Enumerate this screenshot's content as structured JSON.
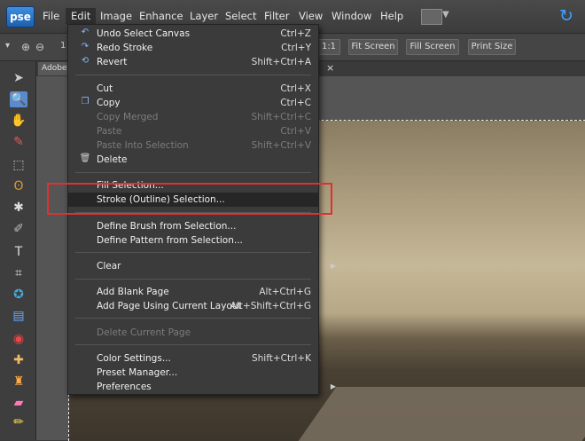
{
  "app": {
    "logo": "pse"
  },
  "menubar": {
    "items": [
      "File",
      "Edit",
      "Image",
      "Enhance",
      "Layer",
      "Select",
      "Filter",
      "View",
      "Window",
      "Help"
    ],
    "active": "Edit"
  },
  "options": {
    "zoom_prefix": "1",
    "ratio": "1:1",
    "fit_screen": "Fit Screen",
    "fill_screen": "Fill Screen",
    "print_size": "Print Size"
  },
  "document_tab": {
    "label": "Adobe",
    "close": "×"
  },
  "edit_menu": {
    "items": [
      {
        "label": "Undo Select Canvas",
        "shortcut": "Ctrl+Z",
        "enabled": true,
        "icon": "undo-icon"
      },
      {
        "label": "Redo Stroke",
        "shortcut": "Ctrl+Y",
        "enabled": true,
        "icon": "redo-icon"
      },
      {
        "label": "Revert",
        "shortcut": "Shift+Ctrl+A",
        "enabled": true,
        "icon": "revert-icon"
      },
      {
        "label": "Cut",
        "shortcut": "Ctrl+X",
        "enabled": true
      },
      {
        "label": "Copy",
        "shortcut": "Ctrl+C",
        "enabled": true,
        "icon": "copy-icon"
      },
      {
        "label": "Copy Merged",
        "shortcut": "Shift+Ctrl+C",
        "enabled": false
      },
      {
        "label": "Paste",
        "shortcut": "Ctrl+V",
        "enabled": false
      },
      {
        "label": "Paste Into Selection",
        "shortcut": "Shift+Ctrl+V",
        "enabled": false
      },
      {
        "label": "Delete",
        "shortcut": "",
        "enabled": true,
        "icon": "trash-icon"
      },
      {
        "label": "Fill Selection...",
        "shortcut": "",
        "enabled": true
      },
      {
        "label": "Stroke (Outline) Selection...",
        "shortcut": "",
        "enabled": true,
        "highlighted": true
      },
      {
        "label": "Define Brush from Selection...",
        "shortcut": "",
        "enabled": true
      },
      {
        "label": "Define Pattern from Selection...",
        "shortcut": "",
        "enabled": true
      },
      {
        "label": "Clear",
        "shortcut": "",
        "enabled": true,
        "submenu": true
      },
      {
        "label": "Add Blank Page",
        "shortcut": "Alt+Ctrl+G",
        "enabled": true
      },
      {
        "label": "Add Page Using Current Layout",
        "shortcut": "Alt+Shift+Ctrl+G",
        "enabled": true
      },
      {
        "label": "Delete Current Page",
        "shortcut": "",
        "enabled": false
      },
      {
        "label": "Color Settings...",
        "shortcut": "Shift+Ctrl+K",
        "enabled": true
      },
      {
        "label": "Preset Manager...",
        "shortcut": "",
        "enabled": true
      },
      {
        "label": "Preferences",
        "shortcut": "",
        "enabled": true,
        "submenu": true
      }
    ]
  },
  "colors": {
    "highlight_box": "#e03030",
    "menu_bg": "#3b3b3b",
    "accent": "#3fa0ff"
  }
}
